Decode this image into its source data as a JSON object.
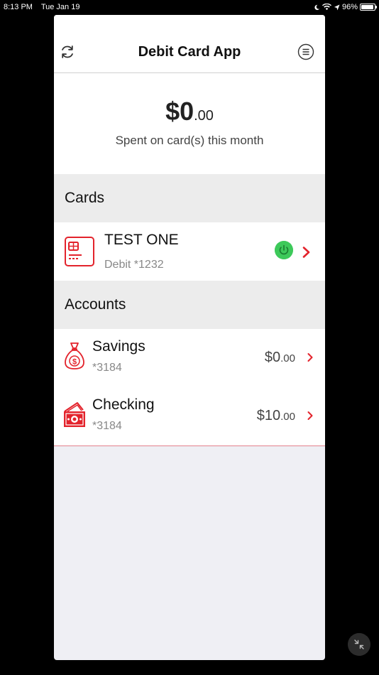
{
  "status_bar": {
    "time": "8:13 PM",
    "date": "Tue Jan 19",
    "battery": "96%"
  },
  "navbar": {
    "title": "Debit Card App"
  },
  "summary": {
    "dollars": "$0",
    "cents": ".00",
    "label": "Spent on card(s) this month"
  },
  "cards_section": {
    "header": "Cards",
    "items": [
      {
        "name": "TEST ONE",
        "detail": "Debit *1232",
        "enabled": true
      }
    ]
  },
  "accounts_section": {
    "header": "Accounts",
    "items": [
      {
        "name": "Savings",
        "number": "*3184",
        "dollars": "$0",
        "cents": ".00"
      },
      {
        "name": "Checking",
        "number": "*3184",
        "dollars": "$10",
        "cents": ".00"
      }
    ]
  },
  "colors": {
    "accent": "#e3232c",
    "power_on": "#3dc95a"
  }
}
